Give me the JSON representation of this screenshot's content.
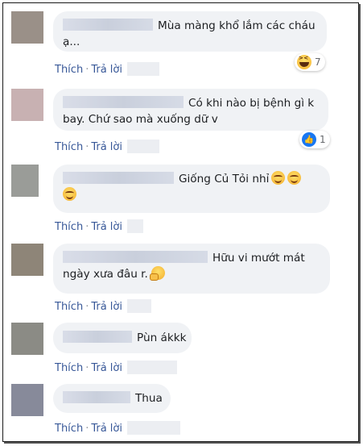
{
  "actions": {
    "like": "Thích",
    "reply": "Trả lời",
    "sep": "·"
  },
  "colors": {
    "bubble": "#f0f2f5",
    "link": "#385898",
    "like_blue": "#1877f2"
  },
  "comments": [
    {
      "avatar_color": "#9a9088",
      "text_lines": [
        "Mùa màng khổ lắm các cháu",
        "ạ..."
      ],
      "reaction": {
        "icon": "haha-reaction-icon",
        "count": "7"
      }
    },
    {
      "avatar_color": "#c8b1b2",
      "text_lines": [
        "Có khi nào bị bệnh gì k",
        "bay. Chứ sao mà xuống dữ v"
      ],
      "reaction": {
        "icon": "like-reaction-icon",
        "count": "1"
      }
    },
    {
      "avatar_color": "#9a9c98",
      "text_lines": [
        "Giống Củ Tỏi nhỉ",
        ""
      ],
      "emoji": "smiling-face-icon"
    },
    {
      "avatar_color": "#8e8578",
      "text_lines": [
        "Hữu vi mướt mát",
        "ngày xưa đâu r."
      ],
      "emoji": "thinking-face-icon"
    },
    {
      "avatar_color": "#8b8b85",
      "text_lines": [
        "Pùn ákkk"
      ]
    },
    {
      "avatar_color": "#878a9a",
      "text_lines": [
        "Thua"
      ]
    }
  ]
}
